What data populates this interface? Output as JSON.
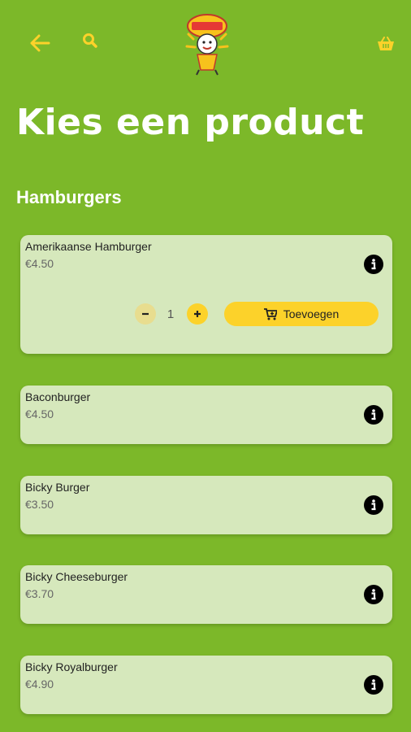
{
  "header": {
    "back_icon": "arrow-left-icon",
    "search_icon": "search-icon",
    "cart_icon": "basket-icon",
    "logo": "restaurant-logo",
    "icon_color": "#fcd22a"
  },
  "page": {
    "title": "Kies een product",
    "section": "Hamburgers"
  },
  "products": [
    {
      "name": "Amerikaanse Hamburger",
      "price": "€4.50",
      "expanded": true,
      "quantity": "1",
      "add_label": "Toevoegen"
    },
    {
      "name": "Baconburger",
      "price": "€4.50"
    },
    {
      "name": "Bicky Burger",
      "price": "€3.50"
    },
    {
      "name": "Bicky Cheeseburger",
      "price": "€3.70"
    },
    {
      "name": "Bicky Royalburger",
      "price": "€4.90"
    }
  ]
}
